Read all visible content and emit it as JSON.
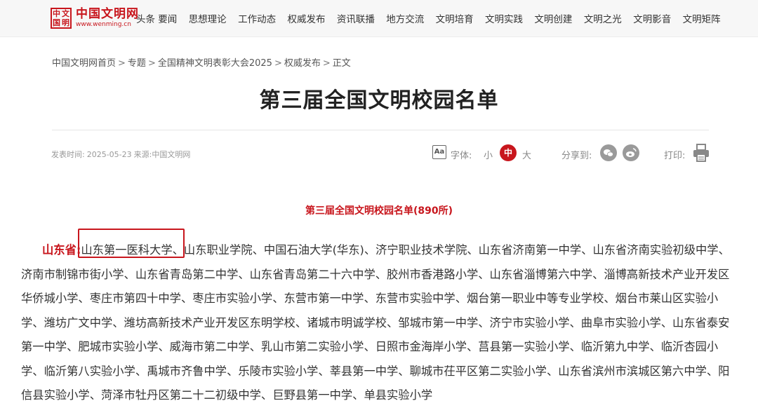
{
  "site": {
    "seal_chars": [
      "中",
      "文",
      "国",
      "明"
    ],
    "name": "中国文明网",
    "domain": "www.wenming.cn",
    "brand_color": "#c8161d"
  },
  "nav": [
    "头条 要闻",
    "思想理论",
    "工作动态",
    "权威发布",
    "资讯联播",
    "地方交流",
    "文明培育",
    "文明实践",
    "文明创建",
    "文明之光",
    "文明影音",
    "文明矩阵"
  ],
  "breadcrumb": [
    "中国文明网首页",
    "专题",
    "全国精神文明表彰大会2025",
    "权威发布",
    "正文"
  ],
  "breadcrumb_separator": ">",
  "article": {
    "title": "第三届全国文明校园名单",
    "publish_label": "发表时间:",
    "publish_date": "2025-05-23",
    "source_label": "来源:",
    "source": "中国文明网",
    "subheading": "第三届全国文明校园名单(890所)",
    "province": "山东省:",
    "highlighted_school": "山东第一医科大学、",
    "schools_rest": "山东职业学院、中国石油大学(华东)、济宁职业技术学院、山东省济南第一中学、山东省济南实验初级中学、济南市制锦市街小学、山东省青岛第二中学、山东省青岛第二十六中学、胶州市香港路小学、山东省淄博第六中学、淄博高新技术产业开发区华侨城小学、枣庄市第四十中学、枣庄市实验小学、东营市第一中学、东营市实验中学、烟台第一职业中等专业学校、烟台市莱山区实验小学、潍坊广文中学、潍坊高新技术产业开发区东明学校、诸城市明诚学校、邹城市第一中学、济宁市实验小学、曲阜市实验小学、山东省泰安第一中学、肥城市实验小学、威海市第二中学、乳山市第二实验小学、日照市金海岸小学、莒县第一实验小学、临沂第九中学、临沂杏园小学、临沂第八实验小学、禹城市齐鲁中学、乐陵市实验小学、莘县第一中学、聊城市茌平区第二实验小学、山东省滨州市滨城区第六中学、阳信县实验小学、菏泽市牡丹区第二十二初级中学、巨野县第一中学、单县实验小学"
  },
  "tools": {
    "font_icon_text": "Aa",
    "font_label": "字体:",
    "size_small": "小",
    "size_medium": "中",
    "size_large": "大",
    "share_label": "分享到:",
    "share_wechat_icon": "wechat-icon",
    "share_weibo_icon": "weibo-icon",
    "print_label": "打印:"
  }
}
